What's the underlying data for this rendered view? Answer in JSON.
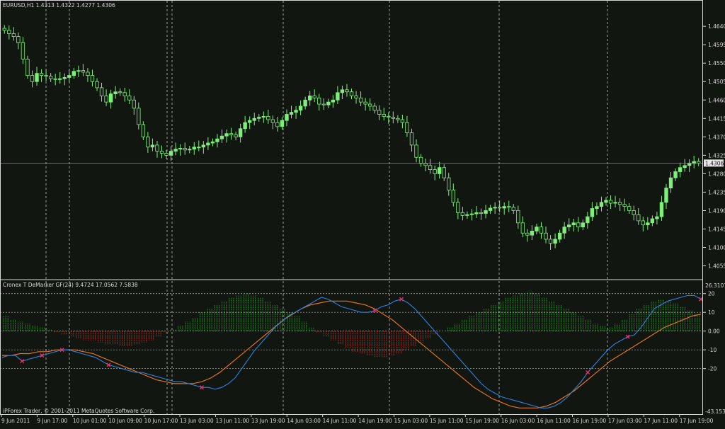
{
  "header": {
    "symbol_line": "EURUSD,H1  1.4313 1.4322 1.4277 1.4306",
    "indicator_line": "Cronex T DeMarker GF(24) 9.4724 17.0562 7.5838",
    "copyright": "iPForex Trader, © 2001-2011 MetaQuotes Software Corp."
  },
  "colors": {
    "background": "#121611",
    "frame": "#d8d8d8",
    "bull": "#7ef07a",
    "bear": "#1a1f1a",
    "wick": "#7ef07a",
    "hist_up": "#2fbf2f",
    "hist_down": "#e03a3a",
    "fast_line": "#2b83e0",
    "slow_line": "#e0731f",
    "cross_marker": "#ff2a6a",
    "current_price_line": "#8a8a8a"
  },
  "chart_data": [
    {
      "type": "candlestick",
      "symbol": "EURUSD",
      "timeframe": "H1",
      "last_ohlc": {
        "open": 1.4313,
        "high": 1.4322,
        "low": 1.4277,
        "close": 1.4306
      },
      "current_price_label": "1.4306",
      "y_ticks": [
        "1.4640",
        "1.4595",
        "1.4550",
        "1.4505",
        "1.4460",
        "1.4415",
        "1.4370",
        "1.4325",
        "1.4280",
        "1.4235",
        "1.4190",
        "1.4145",
        "1.4100",
        "1.4055"
      ],
      "ylim": [
        1.403,
        1.468
      ],
      "x_ticks": [
        "9 Jun 2011",
        "9 Jun 17:00",
        "10 Jun 01:00",
        "10 Jun 09:00",
        "10 Jun 17:00",
        "13 Jun 03:00",
        "13 Jun 11:00",
        "13 Jun 19:00",
        "14 Jun 03:00",
        "14 Jun 11:00",
        "14 Jun 19:00",
        "15 Jun 03:00",
        "15 Jun 11:00",
        "15 Jun 19:00",
        "16 Jun 03:00",
        "16 Jun 11:00",
        "16 Jun 19:00",
        "17 Jun 03:00",
        "17 Jun 11:00",
        "17 Jun 19:00"
      ],
      "close_path": [
        1.463,
        1.4622,
        1.4615,
        1.46,
        1.456,
        1.452,
        1.4505,
        1.4525,
        1.452,
        1.4518,
        1.4512,
        1.451,
        1.4512,
        1.4515,
        1.452,
        1.453,
        1.4532,
        1.4528,
        1.452,
        1.4505,
        1.449,
        1.447,
        1.4455,
        1.4475,
        1.448,
        1.4478,
        1.447,
        1.446,
        1.444,
        1.44,
        1.437,
        1.4345,
        1.435,
        1.4335,
        1.433,
        1.4325,
        1.4335,
        1.434,
        1.4342,
        1.4338,
        1.434,
        1.4345,
        1.4345,
        1.435,
        1.4355,
        1.4358,
        1.4365,
        1.4372,
        1.4378,
        1.4375,
        1.437,
        1.439,
        1.4405,
        1.441,
        1.4415,
        1.4418,
        1.442,
        1.4412,
        1.4405,
        1.4395,
        1.441,
        1.4425,
        1.443,
        1.4435,
        1.4445,
        1.446,
        1.447,
        1.4465,
        1.445,
        1.4448,
        1.4455,
        1.446,
        1.4478,
        1.4485,
        1.448,
        1.447,
        1.4465,
        1.4455,
        1.445,
        1.4445,
        1.4435,
        1.4425,
        1.442,
        1.4418,
        1.4415,
        1.4412,
        1.4405,
        1.438,
        1.435,
        1.432,
        1.4305,
        1.43,
        1.429,
        1.428,
        1.4295,
        1.427,
        1.424,
        1.421,
        1.4185,
        1.4178,
        1.418,
        1.4182,
        1.4185,
        1.4183,
        1.419,
        1.4196,
        1.4198,
        1.4196,
        1.42,
        1.4198,
        1.419,
        1.416,
        1.4135,
        1.413,
        1.414,
        1.415,
        1.4135,
        1.412,
        1.411,
        1.412,
        1.4135,
        1.415,
        1.4155,
        1.416,
        1.415,
        1.416,
        1.4175,
        1.4195,
        1.42,
        1.421,
        1.4215,
        1.4208,
        1.421,
        1.4205,
        1.42,
        1.419,
        1.418,
        1.4165,
        1.4155,
        1.416,
        1.417,
        1.4175,
        1.421,
        1.4245,
        1.427,
        1.4285,
        1.4295,
        1.43,
        1.4305,
        1.431,
        1.4306
      ]
    },
    {
      "type": "indicator",
      "name": "Cronex T DeMarker GF(24)",
      "values": [
        9.4724,
        17.0562,
        7.5838
      ],
      "top_label": "26.3107",
      "bottom_label": "-43.1536",
      "y_ticks": [
        "20",
        "10",
        "0.00",
        "-10",
        "-20"
      ],
      "ylim": [
        -43.1536,
        26.3107
      ],
      "fast_line": [
        -14,
        -13,
        -13,
        -16,
        -15,
        -14,
        -13,
        -12,
        -11,
        -10,
        -10,
        -11,
        -12,
        -13,
        -14,
        -16,
        -18,
        -19,
        -20,
        -21,
        -22,
        -22,
        -23,
        -24,
        -25,
        -26,
        -27,
        -27,
        -28,
        -29,
        -30,
        -30,
        -31,
        -30,
        -28,
        -25,
        -20,
        -15,
        -10,
        -6,
        -2,
        2,
        5,
        8,
        10,
        12,
        14,
        16,
        18,
        17,
        15,
        13,
        12,
        11,
        10,
        10,
        11,
        13,
        14,
        16,
        17,
        15,
        12,
        8,
        4,
        0,
        -4,
        -8,
        -12,
        -16,
        -20,
        -24,
        -28,
        -31,
        -33,
        -35,
        -36,
        -37,
        -38,
        -39,
        -40,
        -41,
        -41,
        -40,
        -38,
        -35,
        -31,
        -27,
        -22,
        -18,
        -14,
        -10,
        -7,
        -5,
        -3,
        -2,
        2,
        7,
        12,
        14,
        16,
        17,
        18,
        19,
        19,
        17
      ],
      "slow_line": [
        -13,
        -13,
        -12,
        -12,
        -11,
        -11,
        -10,
        -10,
        -10,
        -11,
        -12,
        -14,
        -16,
        -18,
        -20,
        -22,
        -24,
        -26,
        -27,
        -28,
        -28,
        -28,
        -27,
        -25,
        -22,
        -18,
        -14,
        -10,
        -6,
        -2,
        2,
        6,
        9,
        12,
        14,
        15,
        16,
        16,
        16,
        15,
        14,
        12,
        9,
        6,
        2,
        -2,
        -6,
        -10,
        -14,
        -18,
        -22,
        -26,
        -30,
        -33,
        -36,
        -38,
        -40,
        -41,
        -41,
        -41,
        -40,
        -38,
        -35,
        -32,
        -28,
        -24,
        -20,
        -16,
        -13,
        -10,
        -7,
        -4,
        -1,
        2,
        4,
        6,
        8,
        9
      ],
      "histogram": [
        8,
        6,
        5,
        4,
        3,
        2,
        1,
        -1,
        -2,
        -3,
        -4,
        -5,
        -5,
        -6,
        -7,
        -7,
        -8,
        -8,
        -7,
        -6,
        -5,
        -3,
        -1,
        1,
        3,
        5,
        7,
        10,
        12,
        14,
        16,
        18,
        19,
        20,
        19,
        18,
        16,
        14,
        12,
        10,
        8,
        5,
        2,
        -1,
        -3,
        -5,
        -7,
        -9,
        -11,
        -12,
        -13,
        -14,
        -14,
        -13,
        -12,
        -10,
        -8,
        -6,
        -4,
        -2,
        0,
        2,
        4,
        6,
        8,
        10,
        12,
        14,
        16,
        18,
        19,
        20,
        21,
        20,
        18,
        16,
        14,
        12,
        10,
        8,
        6,
        4,
        3,
        2,
        4,
        6,
        9,
        12,
        14,
        16,
        17,
        16,
        15,
        13,
        11,
        9
      ],
      "crossovers": [
        3,
        6,
        9,
        16,
        30,
        56,
        60,
        88,
        94,
        123,
        127
      ]
    }
  ]
}
